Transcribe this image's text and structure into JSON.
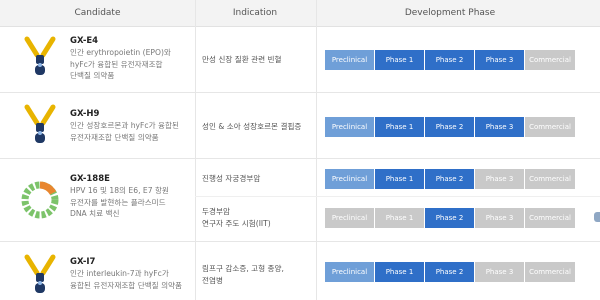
{
  "header": {
    "candidate": "Candidate",
    "indication": "Indication",
    "phase": "Development Phase"
  },
  "phase_labels": [
    "Preclinical",
    "Phase 1",
    "Phase 2",
    "Phase 3",
    "Commercial"
  ],
  "colors": {
    "active": "#2f6fc8",
    "preclinical": "#6f9fd8",
    "inactive": "#c9c9c9",
    "antibody_yellow": "#e8b400",
    "antibody_navy": "#1f3864",
    "plasmid_green": "#7cc36a",
    "plasmid_orange": "#e8862f"
  },
  "candidates": [
    {
      "name": "GX-E4",
      "icon": "antibody-fc-fusion-icon",
      "desc": [
        "인간 erythropoietin (EPO)와",
        "hyFc가 융합된 유전자재조합",
        "단백질 의약품"
      ],
      "indications": [
        {
          "text": [
            "만성 신장 질환 관련 빈혈"
          ],
          "stage": 4
        }
      ]
    },
    {
      "name": "GX-H9",
      "icon": "antibody-fc-fusion-icon",
      "desc": [
        "인간 성장호르몬과 hyFc가 융합된",
        "유전자재조합 단백질 의약품"
      ],
      "indications": [
        {
          "text": [
            "성인 & 소아 성장호르몬 결핍증"
          ],
          "stage": 4
        }
      ]
    },
    {
      "name": "GX-188E",
      "icon": "dna-plasmid-icon",
      "desc": [
        "HPV 16 및 18의 E6, E7 항원",
        "유전자를 발현하는 플라스미드",
        "DNA 치료 백신"
      ],
      "indications": [
        {
          "text": [
            "진행성 자궁경부암"
          ],
          "stage": 3
        },
        {
          "text": [
            "두경부암",
            "연구자 주도 시험(IIT)"
          ],
          "stage": 3
        }
      ]
    },
    {
      "name": "GX-I7",
      "icon": "antibody-fc-fusion-icon",
      "desc": [
        "인간 interleukin-7과 hyFc가",
        "융합된 유전자재조합 단백질 의약품"
      ],
      "indications": [
        {
          "text": [
            "림프구 감소증, 고형 종양,",
            "전염병"
          ],
          "stage": 3
        }
      ]
    }
  ]
}
